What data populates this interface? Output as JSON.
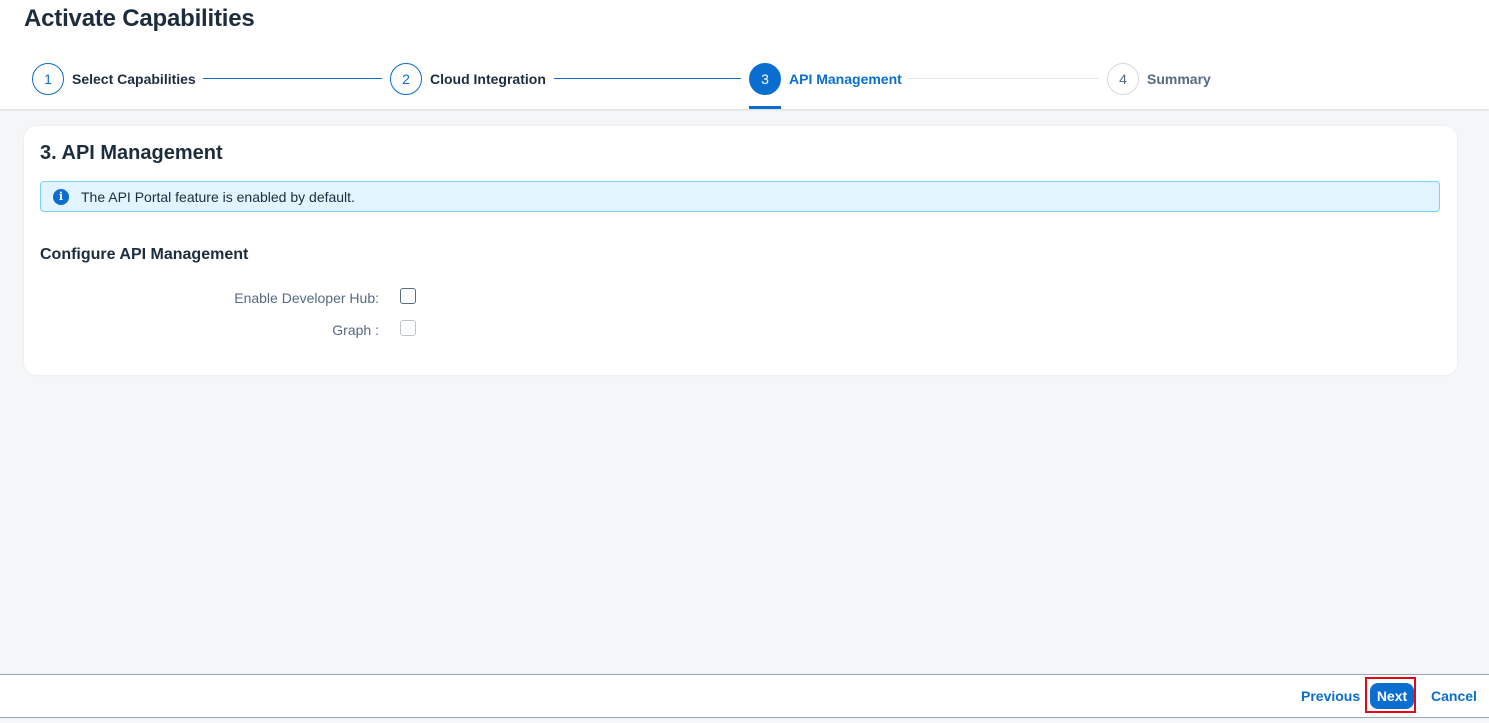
{
  "header": {
    "title": "Activate Capabilities",
    "steps": [
      {
        "number": "1",
        "label": "Select Capabilities"
      },
      {
        "number": "2",
        "label": "Cloud Integration"
      },
      {
        "number": "3",
        "label": "API Management"
      },
      {
        "number": "4",
        "label": "Summary"
      }
    ]
  },
  "main": {
    "section_title": "3. API Management",
    "info_message": "The API Portal feature is enabled by default.",
    "info_icon": "i",
    "sub_title": "Configure API Management",
    "fields": [
      {
        "label": "Enable Developer Hub:",
        "checked": false,
        "disabled": false
      },
      {
        "label": "Graph :",
        "checked": false,
        "disabled": true
      }
    ]
  },
  "footer": {
    "previous_label": "Previous",
    "next_label": "Next",
    "cancel_label": "Cancel"
  },
  "colors": {
    "accent": "#0a6ed1",
    "highlight": "#e30613",
    "info_bg": "#e1f4ff"
  }
}
